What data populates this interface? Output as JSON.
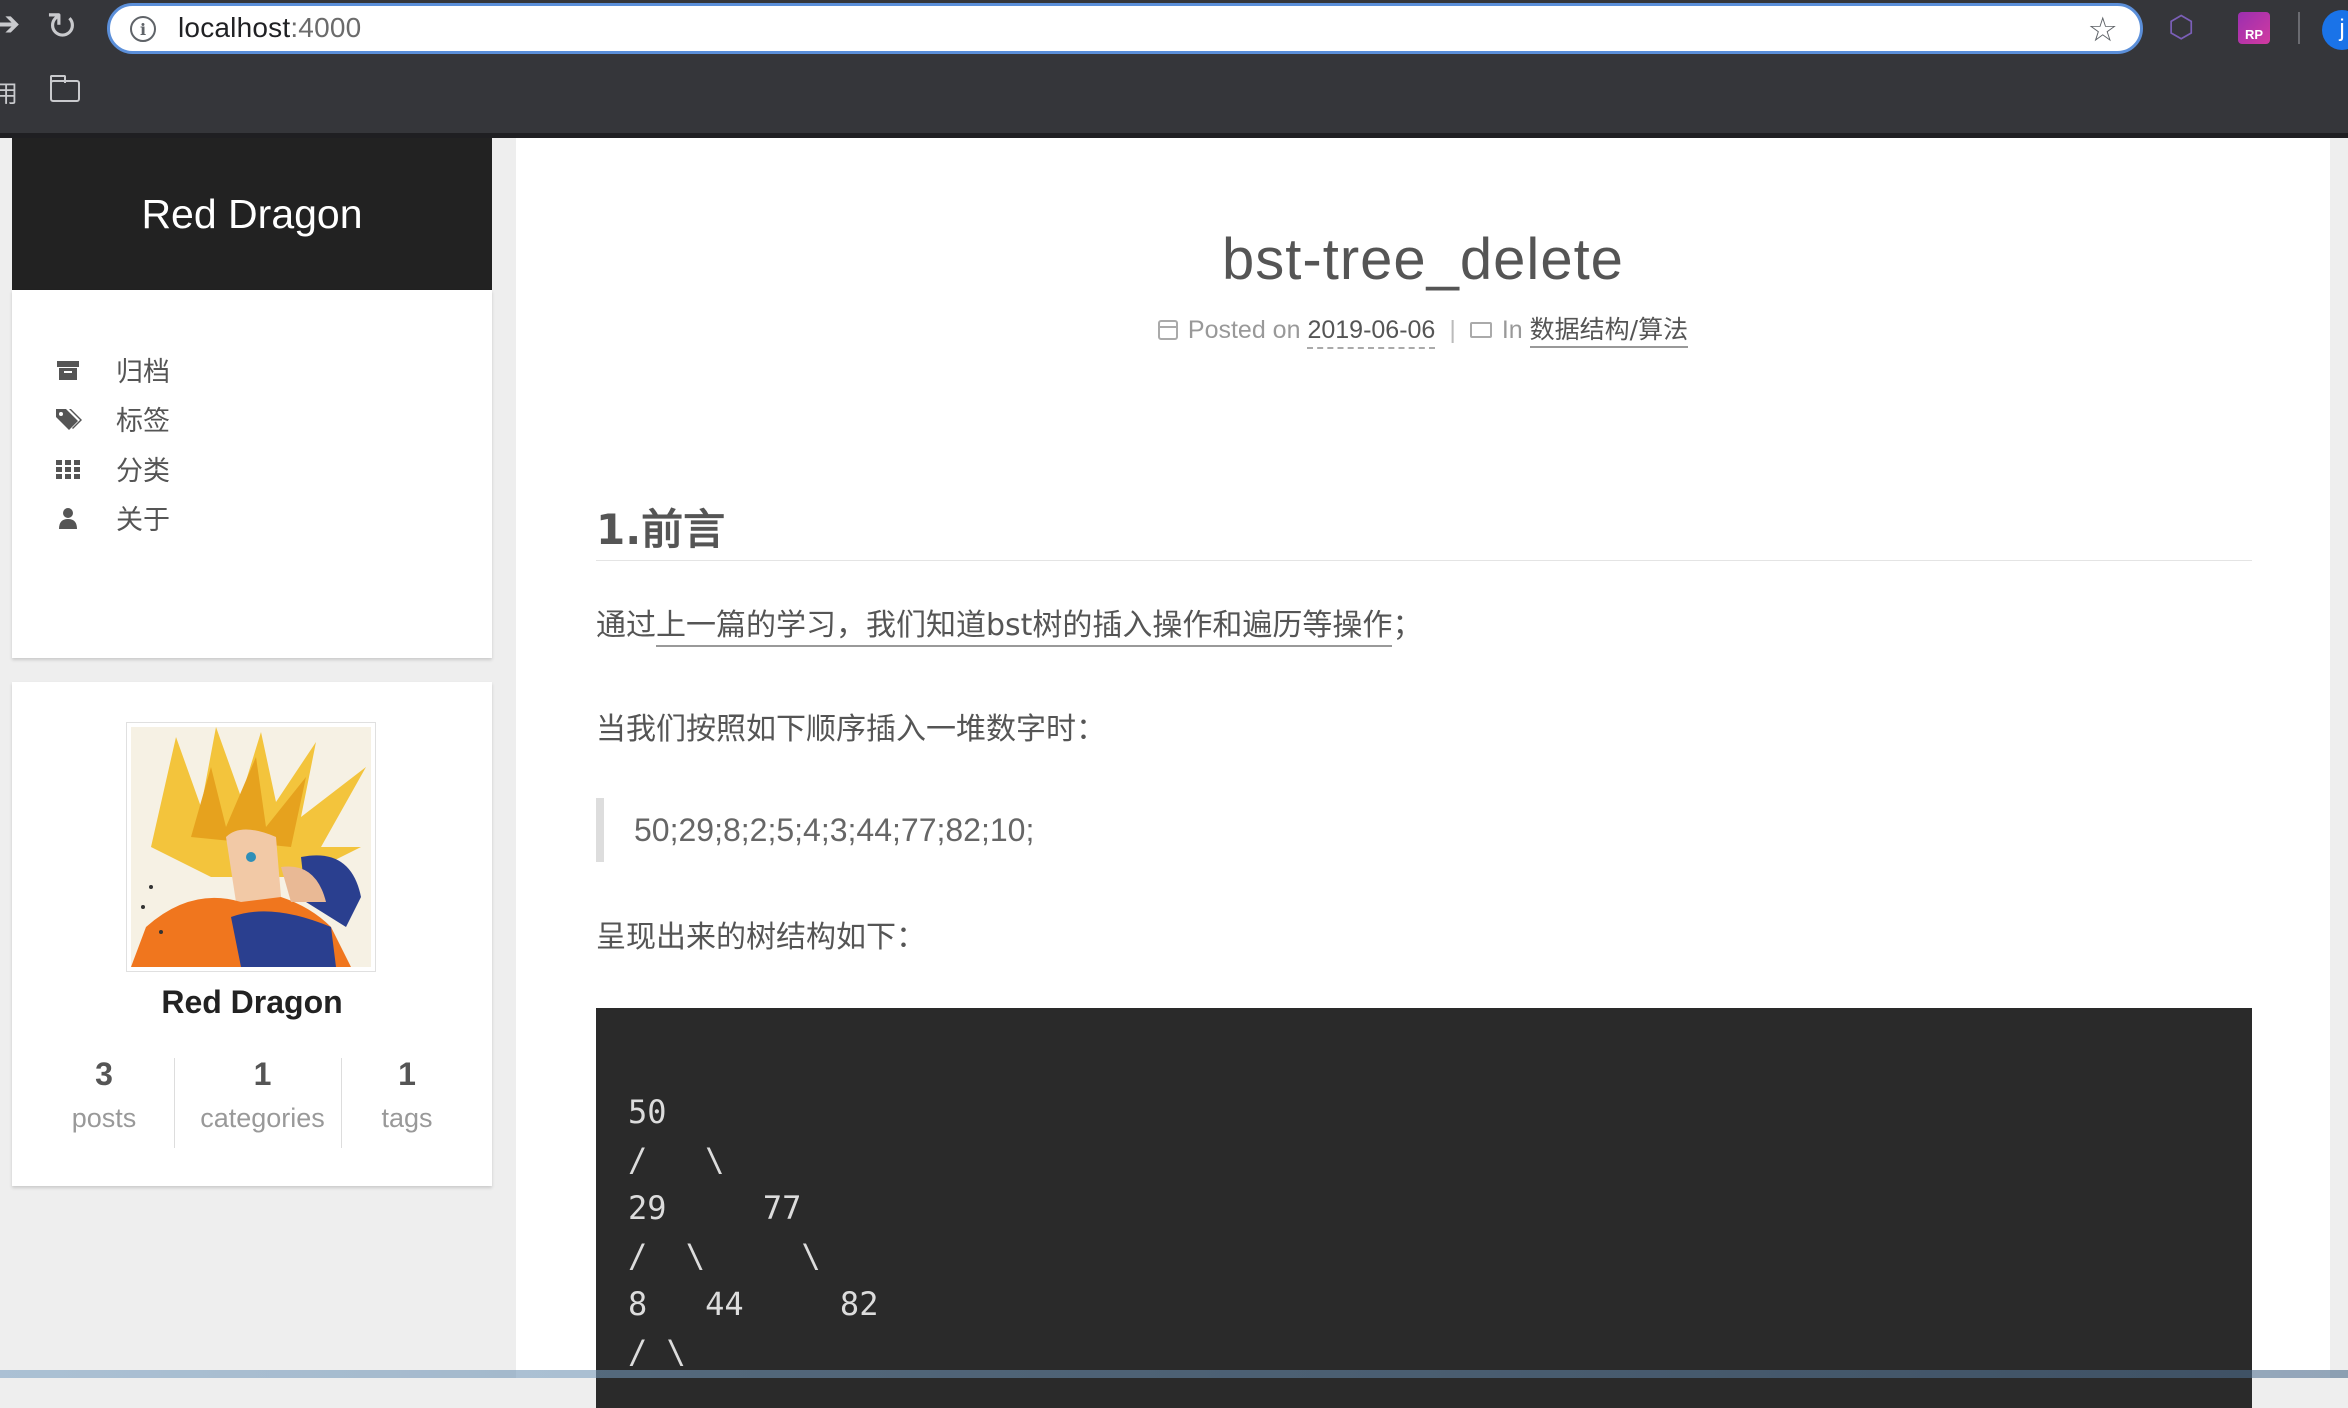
{
  "browser": {
    "url_host": "localhost",
    "url_port": ":4000",
    "profile_initial": "j",
    "bookmark_label": "用",
    "extensions": [
      "cube-icon",
      "rp-icon"
    ],
    "ext_rp_text": "RP"
  },
  "sidebar": {
    "brand": "Red Dragon",
    "menu": [
      {
        "label": "归档",
        "icon": "archive-icon"
      },
      {
        "label": "标签",
        "icon": "tags-icon"
      },
      {
        "label": "分类",
        "icon": "grid-icon"
      },
      {
        "label": "关于",
        "icon": "user-icon"
      }
    ],
    "author": "Red Dragon",
    "stats": [
      {
        "num": "3",
        "label": "posts"
      },
      {
        "num": "1",
        "label": "categories"
      },
      {
        "num": "1",
        "label": "tags"
      }
    ]
  },
  "post": {
    "title": "bst-tree_delete",
    "posted_on_label": "Posted on",
    "date": "2019-06-06",
    "in_label": "In",
    "category": "数据结构/算法",
    "heading": "1.前言",
    "p1_prefix": "通过",
    "p1_link": "上一篇的学习，我们知道bst树的插入操作和遍历等操作",
    "p1_suffix": "；",
    "p2": "当我们按照如下顺序插入一堆数字时：",
    "quote": "50;29;8;2;5;4;3;44;77;82;10;",
    "p3": "呈现出来的树结构如下：",
    "code": "50\n/   \\\n29     77\n/  \\     \\\n8   44     82\n/ \\"
  }
}
